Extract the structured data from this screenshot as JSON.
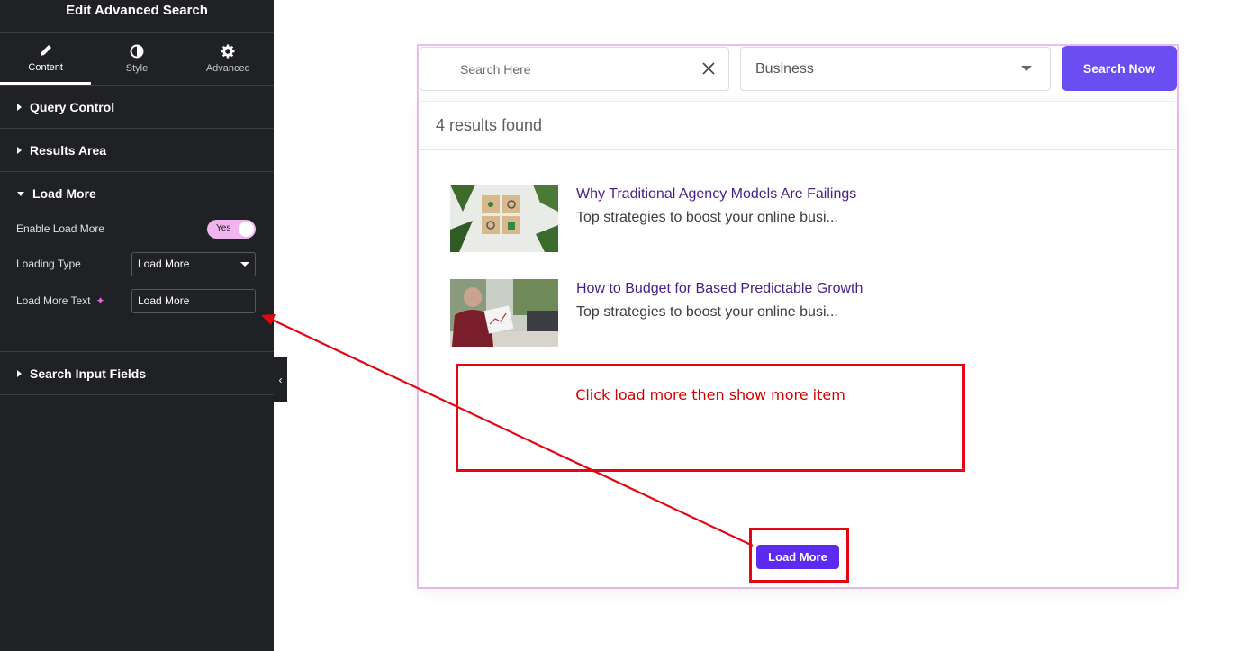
{
  "sidebar": {
    "title": "Edit Advanced Search",
    "tabs": [
      {
        "label": "Content",
        "icon": "pencil-icon"
      },
      {
        "label": "Style",
        "icon": "half-circle-icon"
      },
      {
        "label": "Advanced",
        "icon": "gear-icon"
      }
    ],
    "sections": {
      "query_control": "Query Control",
      "results_area": "Results Area",
      "load_more": "Load More",
      "search_input_fields": "Search Input Fields"
    },
    "controls": {
      "enable_load_more_label": "Enable Load More",
      "enable_load_more_value": "Yes",
      "loading_type_label": "Loading Type",
      "loading_type_value": "Load More",
      "load_more_text_label": "Load More Text",
      "load_more_text_value": "Load More"
    }
  },
  "preview": {
    "search_placeholder": "Search Here",
    "category_selected": "Business",
    "search_button": "Search Now",
    "results_count": "4 results found",
    "results": [
      {
        "title": "Why Traditional Agency Models Are Failings",
        "excerpt": "Top strategies to boost your online busi..."
      },
      {
        "title": "How to Budget for Based Predictable Growth",
        "excerpt": "Top strategies to boost your online busi..."
      }
    ],
    "load_more_button": "Load More"
  },
  "annotation": {
    "text": "Click load more then show more item"
  },
  "colors": {
    "sidebar_bg": "#202124",
    "accent_purple": "#6b4ef2",
    "load_more_purple": "#5d2af0",
    "annotation_red": "#e30613",
    "toggle_pink": "#f0b4ee",
    "result_title": "#4a1e8a"
  }
}
